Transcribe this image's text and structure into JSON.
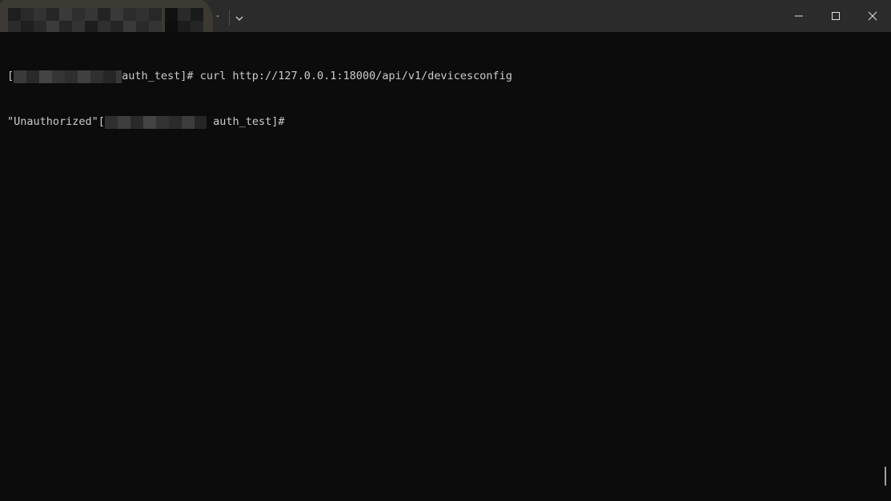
{
  "titlebar": {
    "tab_close_label": "-",
    "icons": {
      "dropdown": "chevron-down-icon",
      "minimize": "minimize-icon",
      "maximize": "maximize-icon",
      "close": "close-icon"
    }
  },
  "terminal": {
    "lines": [
      {
        "prefix": "[",
        "suffix": "auth_test]# ",
        "command": "curl http://127.0.0.1:18000/api/v1/devicesconfig"
      },
      {
        "output": "\"Unauthorized\"",
        "prefix": "[",
        "suffix": " auth_test]#"
      }
    ]
  },
  "colors": {
    "background": "#0c0c0c",
    "titlebar": "#2b2b2b",
    "text": "#cccccc"
  }
}
